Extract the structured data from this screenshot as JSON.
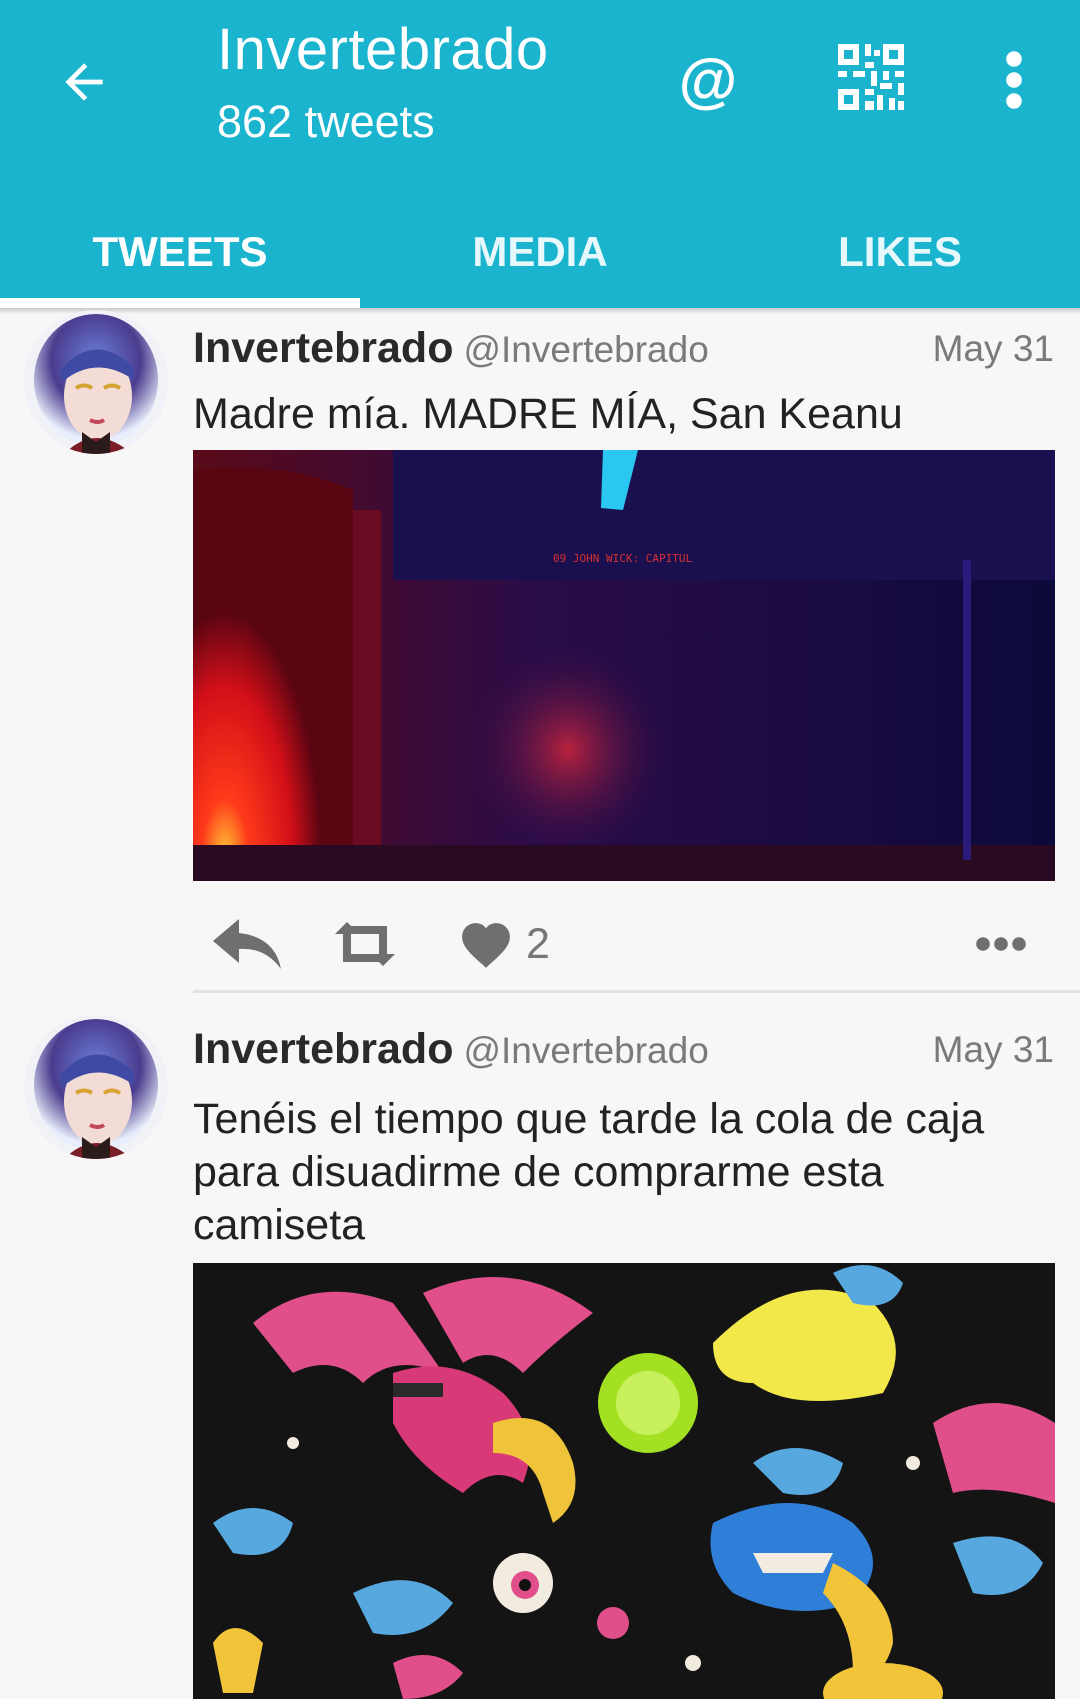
{
  "header": {
    "title": "Invertebrado",
    "subtitle": "862 tweets",
    "at_symbol": "@",
    "accent": "#1ab4cf",
    "icons": [
      "back-arrow-icon",
      "at-icon",
      "qr-code-icon",
      "more-vertical-icon"
    ]
  },
  "tabs": [
    {
      "label": "TWEETS",
      "active": true
    },
    {
      "label": "MEDIA",
      "active": false
    },
    {
      "label": "LIKES",
      "active": false
    }
  ],
  "tweets": [
    {
      "name": "Invertebrado",
      "handle": "@Invertebrado",
      "date": "May 31",
      "text": "Madre mía. MADRE MÍA, San Keanu",
      "media_sign": "09 JOHN WICK: CAPITUL",
      "media_number": "9",
      "likes": "2"
    },
    {
      "name": "Invertebrado",
      "handle": "@Invertebrado",
      "date": "May 31",
      "text": "Tenéis el tiempo que tarde la cola de caja para disuadirme de comprarme esta camiseta"
    }
  ]
}
